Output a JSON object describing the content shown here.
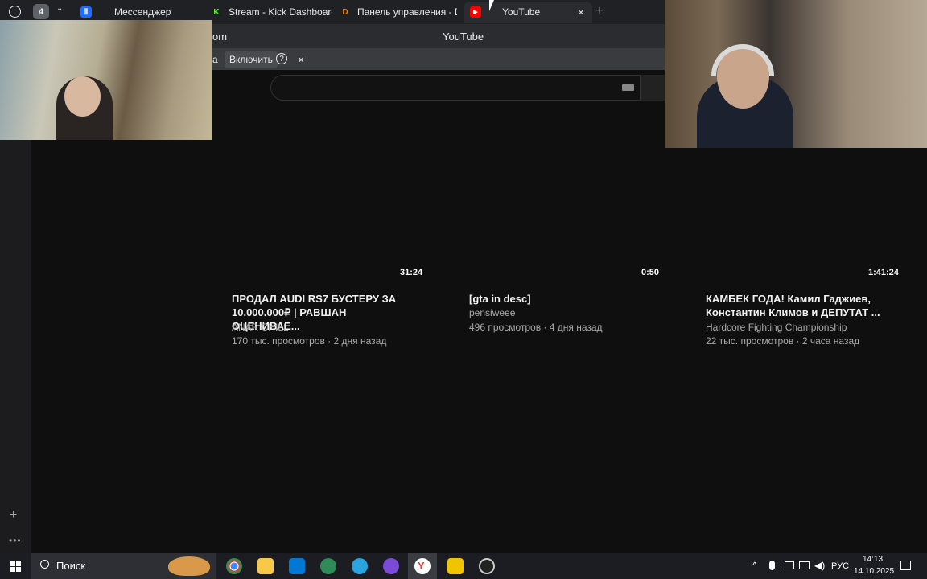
{
  "tabs": [
    {
      "label": "Мессенджер",
      "icon": "messenger-icon",
      "color": "#1e6bff"
    },
    {
      "label": "Stream - Kick Dashboard",
      "icon": "kick-icon",
      "color": "#53fc18"
    },
    {
      "label": "Панель управления - Don",
      "icon": "donation-icon",
      "color": "#f57c00"
    },
    {
      "label": "YouTube",
      "icon": "youtube-icon",
      "color": "#ff0000"
    }
  ],
  "tab_count": "4",
  "toolbar": {
    "url_fragment": "om",
    "page_title": "YouTube"
  },
  "notice": {
    "fragment": "а",
    "enable_label": "Включить",
    "help": "?",
    "close": "×"
  },
  "videos": [
    {
      "duration": "31:24",
      "title_line1": "ПРОДАЛ AUDI RS7 БУСТЕРУ ЗА",
      "title_line2": "10.000.000₽ | РАВШАН ОЦЕНИВАЕ...",
      "channel": "ANAR CHILL",
      "stats": "170 тыс. просмотров · 2 дня назад"
    },
    {
      "duration": "0:50",
      "title_line1": "[gta in desc]",
      "title_line2": "",
      "channel": "pensiweee",
      "stats": "496 просмотров · 4 дня назад"
    },
    {
      "duration": "1:41:24",
      "title_line1": "КАМБЕК ГОДА! Камил Гаджиев,",
      "title_line2": "Константин Климов и ДЕПУТАТ ...",
      "channel": "Hardcore Fighting Championship",
      "stats": "22 тыс. просмотров · 2 часа назад"
    }
  ],
  "taskbar": {
    "search_label": "Поиск",
    "lang": "РУС",
    "time": "14:13",
    "date": "14.10.2025"
  },
  "colors": {
    "bg": "#0f0f0f",
    "tabstrip": "#202124",
    "taskbar": "#1b1d22"
  }
}
